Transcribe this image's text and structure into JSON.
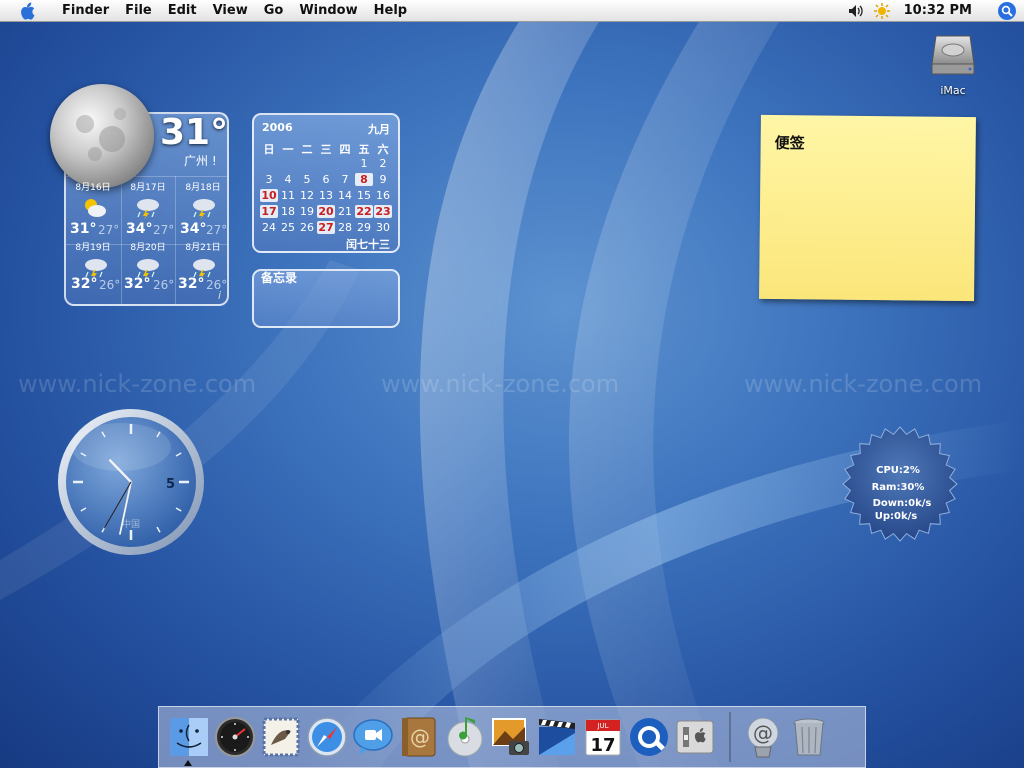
{
  "menubar": {
    "apple_icon": "apple-icon",
    "menus": [
      "Finder",
      "File",
      "Edit",
      "View",
      "Go",
      "Window",
      "Help"
    ],
    "status_icons": [
      "volume-icon",
      "sun-icon",
      "spotlight-icon"
    ],
    "clock": "10:32 PM"
  },
  "desktop": {
    "drive_label": "iMac",
    "watermark": "www.nick-zone.com"
  },
  "weather": {
    "current_temp": "31°",
    "city": "广州 !",
    "info_glyph": "i",
    "days": [
      {
        "date": "8月16日",
        "icon": "partly-cloudy-icon",
        "hi": "31°",
        "lo": "27°"
      },
      {
        "date": "8月17日",
        "icon": "thunderstorm-icon",
        "hi": "34°",
        "lo": "27°"
      },
      {
        "date": "8月18日",
        "icon": "thunderstorm-icon",
        "hi": "34°",
        "lo": "27°"
      },
      {
        "date": "8月19日",
        "icon": "thunderstorm-icon",
        "hi": "32°",
        "lo": "26°"
      },
      {
        "date": "8月20日",
        "icon": "thunderstorm-icon",
        "hi": "32°",
        "lo": "26°"
      },
      {
        "date": "8月21日",
        "icon": "thunderstorm-icon",
        "hi": "32°",
        "lo": "26°"
      }
    ]
  },
  "calendar": {
    "year": "2006",
    "month": "九月",
    "weekdays": [
      "日",
      "一",
      "二",
      "三",
      "四",
      "五",
      "六"
    ],
    "weeks": [
      [
        "",
        "",
        "",
        "",
        "",
        "1",
        "2"
      ],
      [
        "3",
        "4",
        "5",
        "6",
        "7",
        "8",
        "9"
      ],
      [
        "10",
        "11",
        "12",
        "13",
        "14",
        "15",
        "16"
      ],
      [
        "17",
        "18",
        "19",
        "20",
        "21",
        "22",
        "23"
      ],
      [
        "24",
        "25",
        "26",
        "27",
        "28",
        "29",
        "30"
      ]
    ],
    "highlighted": [
      "8",
      "10",
      "17",
      "20",
      "22",
      "23",
      "27"
    ],
    "lunar": "闰七十三"
  },
  "memo": {
    "title": "备忘录"
  },
  "sticky": {
    "title": "便签"
  },
  "clock_widget": {
    "hour": 10,
    "minute": 32,
    "second": 35,
    "numeral": "5",
    "label": "中国"
  },
  "sysmon": {
    "cpu": "CPU:2%",
    "ram": "Ram:30%",
    "down": "Down:0k/s",
    "up": "Up:0k/s"
  },
  "dock": {
    "apps": [
      {
        "name": "Finder",
        "icon": "finder-icon"
      },
      {
        "name": "Dashboard",
        "icon": "dashboard-icon"
      },
      {
        "name": "Mail",
        "icon": "mail-icon"
      },
      {
        "name": "Safari",
        "icon": "safari-icon"
      },
      {
        "name": "iChat",
        "icon": "ichat-icon"
      },
      {
        "name": "Address Book",
        "icon": "address-book-icon"
      },
      {
        "name": "iTunes",
        "icon": "itunes-icon"
      },
      {
        "name": "iPhoto",
        "icon": "iphoto-icon"
      },
      {
        "name": "iMovie",
        "icon": "imovie-icon"
      },
      {
        "name": "iCal",
        "icon": "ical-icon"
      },
      {
        "name": "QuickTime",
        "icon": "quicktime-icon"
      },
      {
        "name": "System Preferences",
        "icon": "system-preferences-icon"
      }
    ],
    "ical_day": "17",
    "ical_month": "JUL",
    "trailing": [
      {
        "name": "Downloads",
        "icon": "at-sign-icon"
      },
      {
        "name": "Trash",
        "icon": "trash-icon"
      }
    ]
  }
}
